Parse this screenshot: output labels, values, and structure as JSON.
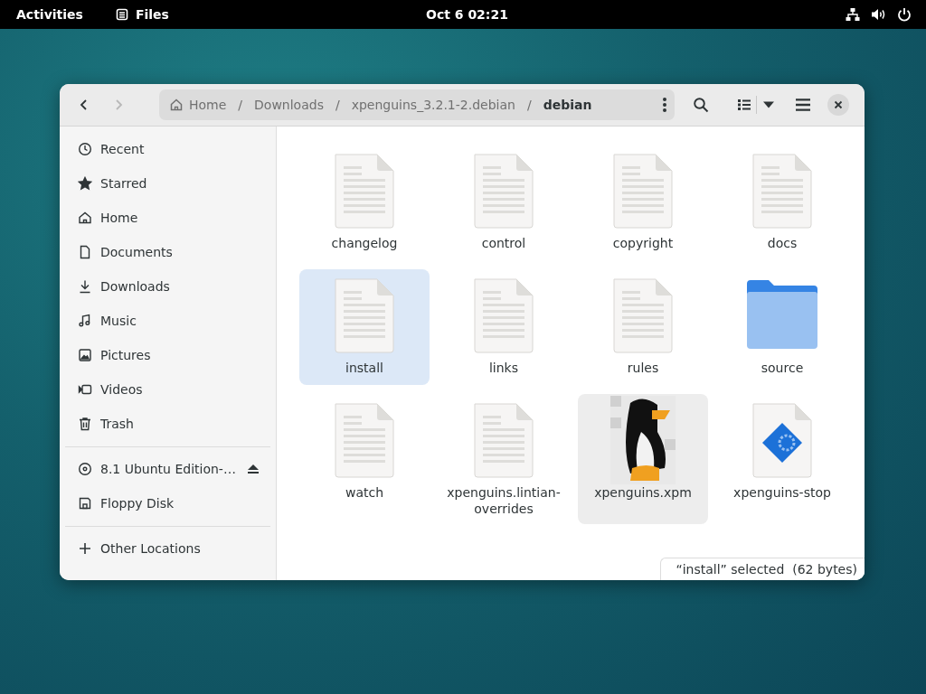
{
  "top_bar": {
    "activities": "Activities",
    "app_name": "Files",
    "clock": "Oct 6  02:21"
  },
  "header": {
    "back_disabled": false,
    "forward_disabled": true,
    "path": [
      {
        "label": "Home",
        "kind": "home",
        "selected": false
      },
      {
        "label": "Downloads",
        "kind": "plain",
        "selected": false
      },
      {
        "label": "xpenguins_3.2.1-2.debian",
        "kind": "plain",
        "selected": false
      },
      {
        "label": "debian",
        "kind": "plain",
        "selected": true
      }
    ],
    "separator": "/"
  },
  "sidebar": {
    "groups": [
      {
        "items": [
          {
            "label": "Recent",
            "kind": "recent",
            "selected": false
          },
          {
            "label": "Starred",
            "kind": "star",
            "selected": false
          },
          {
            "label": "Home",
            "kind": "home",
            "selected": false
          },
          {
            "label": "Documents",
            "kind": "document",
            "selected": false
          },
          {
            "label": "Downloads",
            "kind": "download",
            "selected": false
          },
          {
            "label": "Music",
            "kind": "music",
            "selected": false
          },
          {
            "label": "Pictures",
            "kind": "pictures",
            "selected": false
          },
          {
            "label": "Videos",
            "kind": "video",
            "selected": false
          },
          {
            "label": "Trash",
            "kind": "trash",
            "selected": false
          }
        ]
      },
      {
        "items": [
          {
            "label": "8.1 Ubuntu Edition-…",
            "kind": "disc",
            "selected": false,
            "ejectable": true
          },
          {
            "label": "Floppy Disk",
            "kind": "floppy",
            "selected": false,
            "ejectable": false
          }
        ]
      },
      {
        "items": [
          {
            "label": "Other Locations",
            "kind": "plus",
            "selected": false
          }
        ]
      }
    ]
  },
  "files": [
    {
      "name": "changelog",
      "kind": "text",
      "selected": false,
      "hovered": false
    },
    {
      "name": "control",
      "kind": "text",
      "selected": false,
      "hovered": false
    },
    {
      "name": "copyright",
      "kind": "text",
      "selected": false,
      "hovered": false
    },
    {
      "name": "docs",
      "kind": "text",
      "selected": false,
      "hovered": false
    },
    {
      "name": "install",
      "kind": "text",
      "selected": true,
      "hovered": false
    },
    {
      "name": "links",
      "kind": "text",
      "selected": false,
      "hovered": false
    },
    {
      "name": "rules",
      "kind": "text",
      "selected": false,
      "hovered": false
    },
    {
      "name": "source",
      "kind": "folder",
      "selected": false,
      "hovered": false
    },
    {
      "name": "watch",
      "kind": "text",
      "selected": false,
      "hovered": false
    },
    {
      "name": "xpenguins.lintian-overrides",
      "kind": "text",
      "selected": false,
      "hovered": false
    },
    {
      "name": "xpenguins.xpm",
      "kind": "picture",
      "selected": false,
      "hovered": true
    },
    {
      "name": "xpenguins-stop",
      "kind": "script",
      "selected": false,
      "hovered": false
    }
  ],
  "status": "“install” selected  (62 bytes)"
}
